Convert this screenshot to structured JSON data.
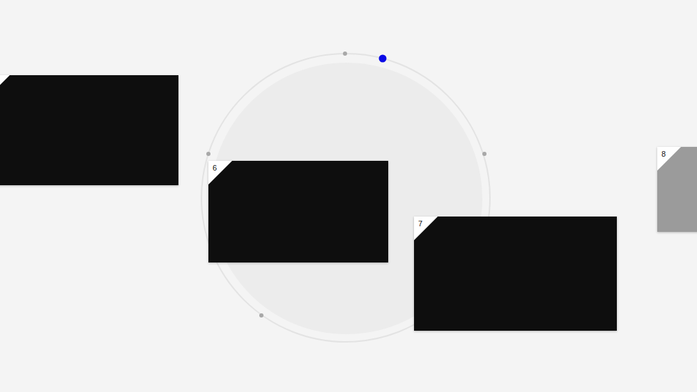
{
  "carousel": {
    "dots": [
      {
        "selected": false
      },
      {
        "selected": true
      },
      {
        "selected": false
      },
      {
        "selected": false
      },
      {
        "selected": false
      }
    ],
    "cards": [
      {
        "number": "",
        "dimmed": false
      },
      {
        "number": "6",
        "dimmed": false
      },
      {
        "number": "7",
        "dimmed": false
      },
      {
        "number": "8",
        "dimmed": true
      }
    ]
  }
}
